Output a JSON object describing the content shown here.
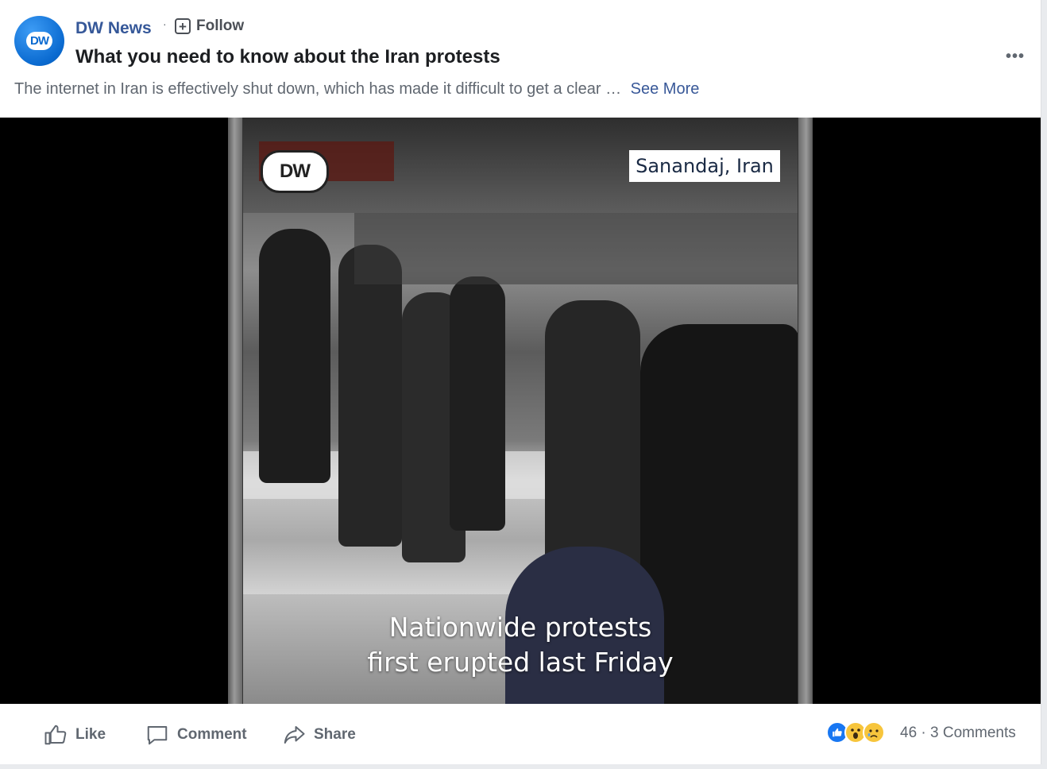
{
  "post": {
    "page_name": "DW News",
    "follow_label": "Follow",
    "title": "What you need to know about the Iran protests",
    "description": "The internet in Iran is effectively shut down, which has made it difficult to get a clear …",
    "see_more": "See More"
  },
  "video": {
    "logo_text": "DW",
    "location": "Sanandaj, Iran",
    "caption_line1": "Nationwide protests",
    "caption_line2": "first erupted last Friday"
  },
  "actions": {
    "like": "Like",
    "comment": "Comment",
    "share": "Share"
  },
  "stats": {
    "reaction_count": "46",
    "separator": "·",
    "comments": "3 Comments"
  },
  "colors": {
    "link": "#365899",
    "like_blue": "#1877f2",
    "reaction_yellow": "#f7c53c"
  },
  "icons": {
    "avatar": "dw-logo",
    "more": "ellipsis-icon",
    "like": "thumbs-up-icon",
    "comment": "speech-bubble-icon",
    "share": "share-arrow-icon"
  }
}
